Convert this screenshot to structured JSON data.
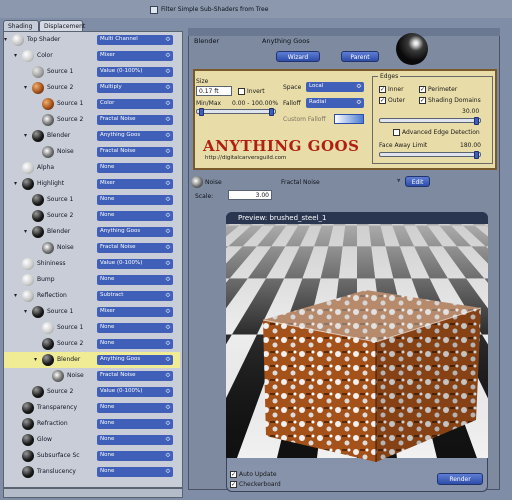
{
  "filter": {
    "label": "Filter Simple Sub-Shaders from Tree",
    "checked": false
  },
  "tabs": [
    "Shading",
    "Displacement"
  ],
  "tree": [
    {
      "label": "Top Shader",
      "value": "Multi Channel",
      "depth": 0,
      "ball": "white",
      "twist": "open"
    },
    {
      "label": "Color",
      "value": "Mixer",
      "depth": 1,
      "ball": "light",
      "twist": "open"
    },
    {
      "label": "Source 1",
      "value": "Value (0-100%)",
      "depth": 2,
      "ball": "gray"
    },
    {
      "label": "Source 2",
      "value": "Multiply",
      "depth": 2,
      "ball": "rust",
      "twist": "open"
    },
    {
      "label": "Source 1",
      "value": "Color",
      "depth": 3,
      "ball": "rust"
    },
    {
      "label": "Source 2",
      "value": "Fractal Noise",
      "depth": 3,
      "ball": "noise"
    },
    {
      "label": "Blender",
      "value": "Anything Goos",
      "depth": 2,
      "ball": "dark",
      "twist": "open"
    },
    {
      "label": "Noise",
      "value": "Fractal Noise",
      "depth": 3,
      "ball": "noise"
    },
    {
      "label": "Alpha",
      "value": "None",
      "depth": 1,
      "ball": "light"
    },
    {
      "label": "Highlight",
      "value": "Mixer",
      "depth": 1,
      "ball": "dark",
      "twist": "open"
    },
    {
      "label": "Source 1",
      "value": "None",
      "depth": 2,
      "ball": "dark"
    },
    {
      "label": "Source 2",
      "value": "None",
      "depth": 2,
      "ball": "dark"
    },
    {
      "label": "Blender",
      "value": "Anything Goos",
      "depth": 2,
      "ball": "dark",
      "twist": "open"
    },
    {
      "label": "Noise",
      "value": "Fractal Noise",
      "depth": 3,
      "ball": "noise"
    },
    {
      "label": "Shininess",
      "value": "Value (0-100%)",
      "depth": 1,
      "ball": "light"
    },
    {
      "label": "Bump",
      "value": "None",
      "depth": 1,
      "ball": "light"
    },
    {
      "label": "Reflection",
      "value": "Subtract",
      "depth": 1,
      "ball": "white",
      "twist": "open"
    },
    {
      "label": "Source 1",
      "value": "Mixer",
      "depth": 2,
      "ball": "dark",
      "twist": "open"
    },
    {
      "label": "Source 1",
      "value": "None",
      "depth": 3,
      "ball": "light"
    },
    {
      "label": "Source 2",
      "value": "None",
      "depth": 3,
      "ball": "dark"
    },
    {
      "label": "Blender",
      "value": "Anything Goos",
      "depth": 3,
      "ball": "dark",
      "twist": "open",
      "highlight": true
    },
    {
      "label": "Noise",
      "value": "Fractal Noise",
      "depth": 4,
      "ball": "noise"
    },
    {
      "label": "Source 2",
      "value": "Value (0-100%)",
      "depth": 2,
      "ball": "dark"
    },
    {
      "label": "Transparency",
      "value": "None",
      "depth": 1,
      "ball": "dark"
    },
    {
      "label": "Refraction",
      "value": "None",
      "depth": 1,
      "ball": "dark"
    },
    {
      "label": "Glow",
      "value": "None",
      "depth": 1,
      "ball": "dark"
    },
    {
      "label": "Subsurface Sc",
      "value": "None",
      "depth": 1,
      "ball": "dark"
    },
    {
      "label": "Translucency",
      "value": "None",
      "depth": 1,
      "ball": "dark"
    }
  ],
  "header": {
    "node_label": "Blender",
    "shader_name": "Anything Goos",
    "wizard_label": "Wizard",
    "parent_label": "Parent"
  },
  "goos": {
    "size_label": "Size",
    "size_value": "0.17 ft",
    "invert_label": "Invert",
    "invert_checked": false,
    "minmax_label": "Min/Max",
    "minmax_value": "0.00 - 100.00%",
    "space_label": "Space",
    "space_value": "Local",
    "falloff_label": "Falloff",
    "falloff_value": "Radial",
    "custom_falloff_label": "Custom Falloff",
    "banner": "ANYTHING GOOS",
    "url": "http://digitalcarversguild.com",
    "edges_label": "Edges",
    "inner_label": "Inner",
    "inner_checked": true,
    "perimeter_label": "Perimeter",
    "perimeter_checked": true,
    "outer_label": "Outer",
    "outer_checked": true,
    "shading_domains_label": "Shading Domains",
    "shading_domains_checked": true,
    "edge_value": "30.00",
    "advanced_edge_label": "Advanced Edge Detection",
    "advanced_edge_checked": false,
    "face_away_label": "Face Away Limit",
    "face_away_value": "180.00"
  },
  "noise": {
    "label": "Noise",
    "type": "Fractal Noise",
    "edit_label": "Edit",
    "scale_label": "Scale:",
    "scale_value": "3.00"
  },
  "preview": {
    "title": "Preview: brushed_steel_1",
    "auto_update_label": "Auto Update",
    "auto_update_checked": true,
    "checkerboard_label": "Checkerboard",
    "checkerboard_checked": true,
    "render_label": "Render"
  },
  "colors": {
    "accent": "#3f5fb8",
    "highlight_row": "#f0ec96",
    "banner_red": "#b11f10",
    "rust": "#a4511a"
  }
}
